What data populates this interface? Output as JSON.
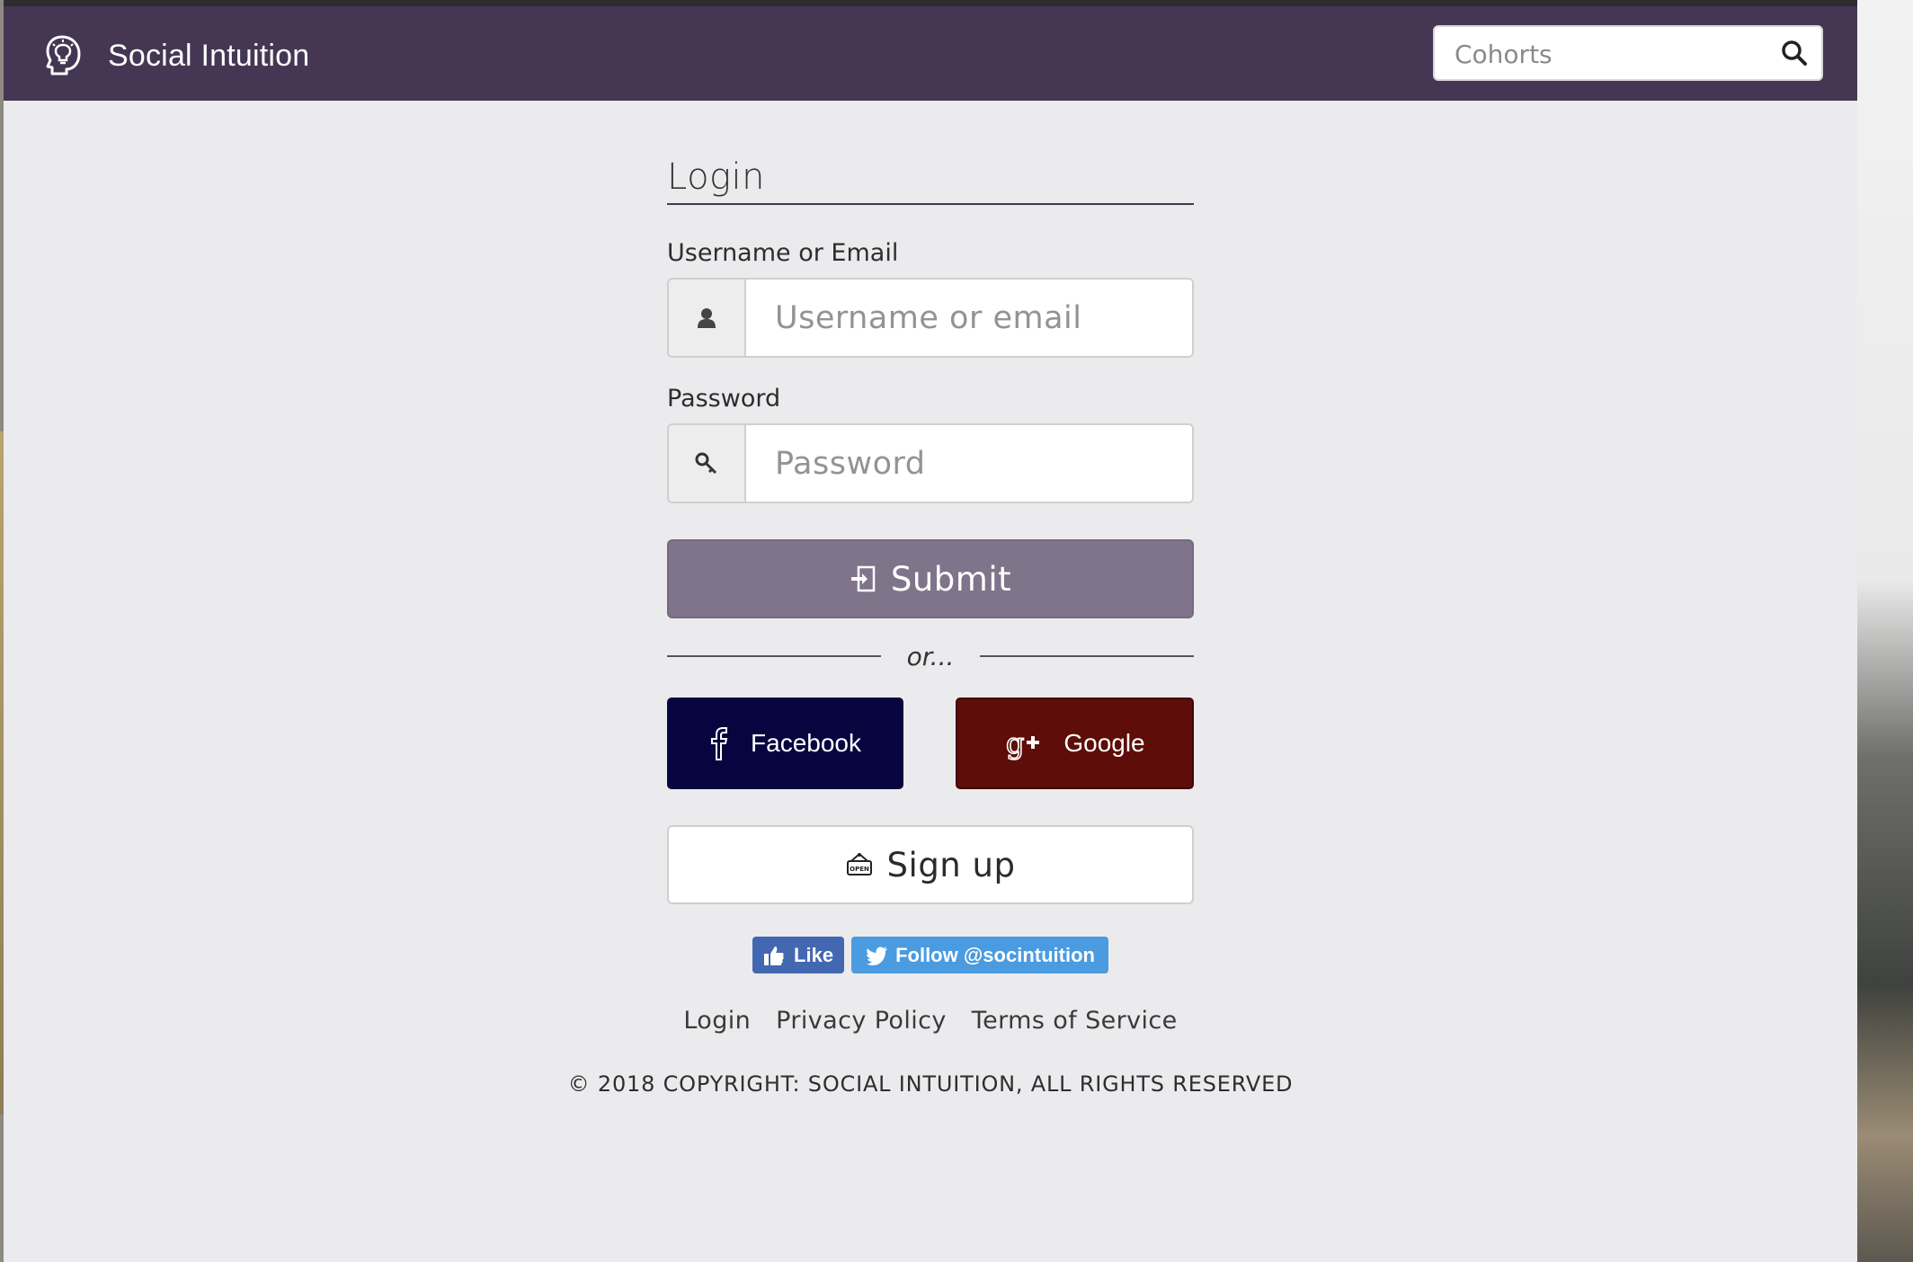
{
  "navbar": {
    "brand_name": "Social Intuition",
    "brand_icon": "brain-head-icon",
    "search_placeholder": "Cohorts",
    "search_icon": "search-icon"
  },
  "login": {
    "title": "Login",
    "username_label": "Username or Email",
    "username_placeholder": "Username or email",
    "username_icon": "user-icon",
    "password_label": "Password",
    "password_placeholder": "Password",
    "password_icon": "key-icon",
    "submit_label": "Submit",
    "submit_icon": "login-icon",
    "or_text": "or...",
    "facebook_label": "Facebook",
    "google_label": "Google",
    "signup_label": "Sign up",
    "signup_icon": "open-sign-icon"
  },
  "share": {
    "like_label": "Like",
    "follow_label": "Follow @socintuition"
  },
  "footer": {
    "links": [
      "Login",
      "Privacy Policy",
      "Terms of Service"
    ],
    "copyright": "© 2018 COPYRIGHT: SOCIAL INTUITION, ALL RIGHTS RESERVED"
  },
  "colors": {
    "navbar": "#453753",
    "submit": "#7f7489",
    "facebook": "#07053f",
    "google": "#5e0d08",
    "like": "#4367b1",
    "twitter": "#4a9be0",
    "background": "#ebebed"
  }
}
